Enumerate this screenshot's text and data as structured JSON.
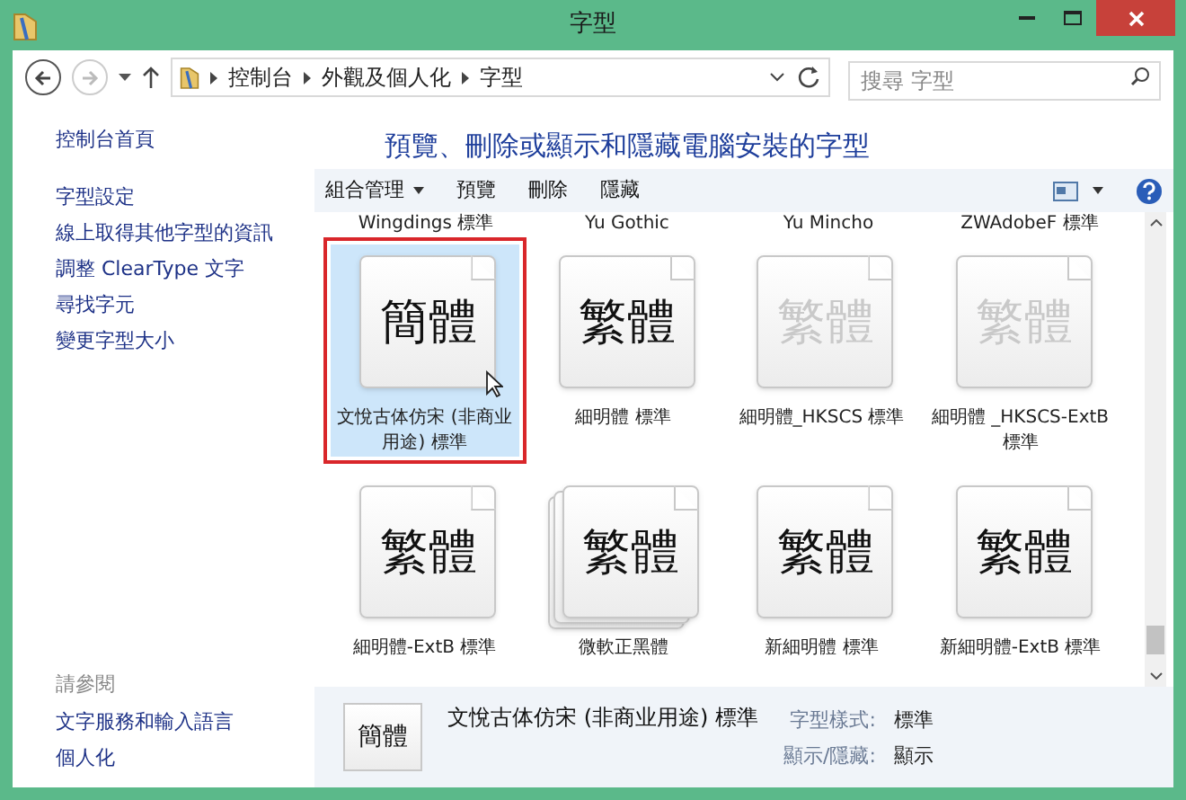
{
  "window": {
    "title": "字型"
  },
  "address_bar": {
    "breadcrumbs": [
      "控制台",
      "外觀及個人化",
      "字型"
    ]
  },
  "search": {
    "placeholder": "搜尋 字型"
  },
  "sidebar": {
    "items": [
      {
        "label": "控制台首頁",
        "kind": "link"
      },
      {
        "label": "字型設定",
        "kind": "link"
      },
      {
        "label": "線上取得其他字型的資訊",
        "kind": "link"
      },
      {
        "label": "調整 ClearType 文字",
        "kind": "link"
      },
      {
        "label": "尋找字元",
        "kind": "link"
      },
      {
        "label": "變更字型大小",
        "kind": "link"
      }
    ],
    "see_also": {
      "title": "請參閱",
      "items": [
        "文字服務和輸入語言",
        "個人化"
      ]
    }
  },
  "heading": "預覽、刪除或顯示和隱藏電腦安裝的字型",
  "toolbar": {
    "items": [
      {
        "label": "組合管理",
        "dropdown": true
      },
      {
        "label": "預覽",
        "dropdown": false
      },
      {
        "label": "刪除",
        "dropdown": false
      },
      {
        "label": "隱藏",
        "dropdown": false
      }
    ]
  },
  "partial_row": [
    "Wingdings 標準",
    "Yu Gothic",
    "Yu Mincho",
    "ZWAdobeF 標準"
  ],
  "fonts": [
    {
      "name": "文悅古体仿宋 (非商业用途) 標準",
      "preview": "簡體",
      "kind": "single",
      "hidden": false,
      "selected": true
    },
    {
      "name": "細明體 標準",
      "preview": "繁體",
      "kind": "single",
      "hidden": false,
      "selected": false
    },
    {
      "name": "細明體_HKSCS 標準",
      "preview": "繁體",
      "kind": "single",
      "hidden": true,
      "selected": false
    },
    {
      "name": "細明體 _HKSCS-ExtB 標準",
      "preview": "繁體",
      "kind": "single",
      "hidden": true,
      "selected": false
    },
    {
      "name": "細明體-ExtB 標準",
      "preview": "繁體",
      "kind": "single",
      "hidden": false,
      "selected": false
    },
    {
      "name": "微軟正黑體",
      "preview": "繁體",
      "kind": "family",
      "hidden": false,
      "selected": false
    },
    {
      "name": "新細明體 標準",
      "preview": "繁體",
      "kind": "single",
      "hidden": false,
      "selected": false
    },
    {
      "name": "新細明體-ExtB 標準",
      "preview": "繁體",
      "kind": "single",
      "hidden": false,
      "selected": false
    }
  ],
  "details": {
    "preview": "簡體",
    "name": "文悅古体仿宋 (非商业用途) 標準",
    "fields": [
      {
        "label": "字型樣式:",
        "value": "標準"
      },
      {
        "label": "顯示/隱藏:",
        "value": "顯示"
      }
    ]
  }
}
